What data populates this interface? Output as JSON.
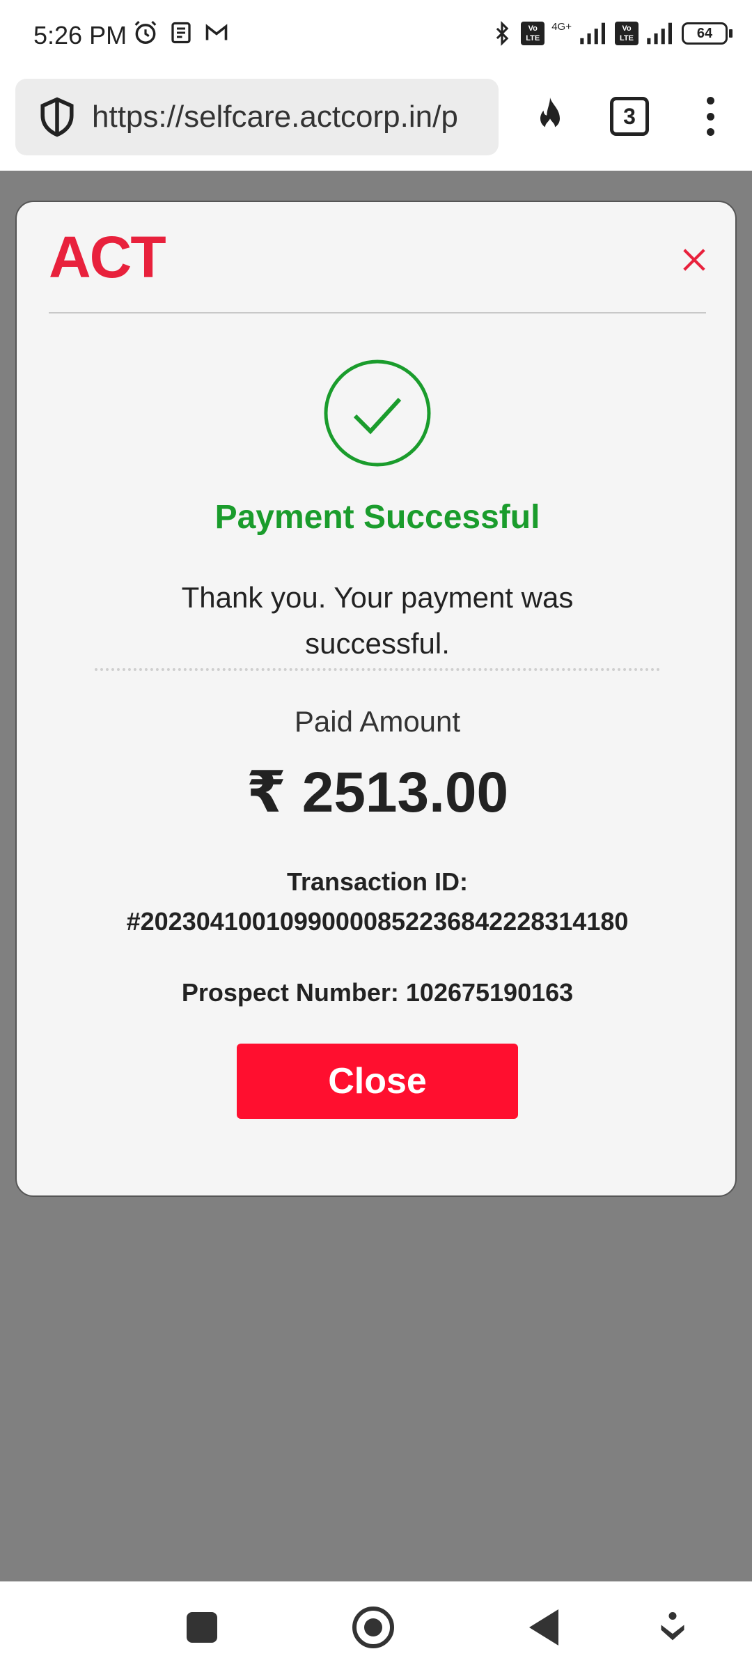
{
  "status_bar": {
    "time": "5:26 PM",
    "network_label": "4G+",
    "volte_label": "Vo LTE",
    "battery": "64"
  },
  "browser": {
    "url": "https://selfcare.actcorp.in/p",
    "tab_count": "3"
  },
  "modal": {
    "brand": "ACT",
    "brand_color": "#e8213c",
    "title": "Payment Successful",
    "title_color": "#1a9c2c",
    "message": "Thank you. Your payment was successful.",
    "paid_label": "Paid Amount",
    "paid_amount": "₹ 2513.00",
    "transaction_label": "Transaction ID:",
    "transaction_id": "#20230410010990000852236842228314180",
    "prospect": "Prospect Number: 102675190163",
    "close_button": "Close",
    "close_button_color": "#ff0f2f",
    "close_icon": "close-icon"
  },
  "nav_bar": {
    "icons": [
      "recents-icon",
      "home-icon",
      "back-icon",
      "assist-icon"
    ]
  }
}
